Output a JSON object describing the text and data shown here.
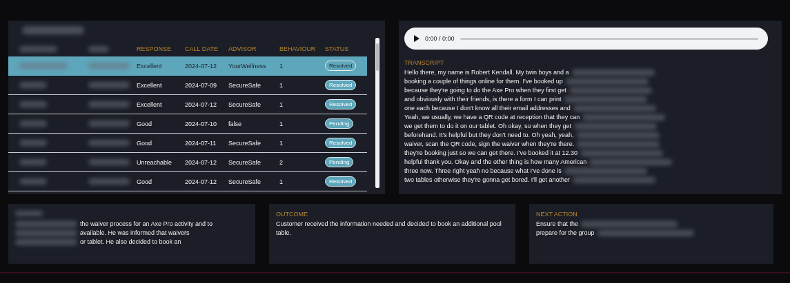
{
  "calls_table": {
    "columns": [
      {
        "kind": "blurred"
      },
      {
        "kind": "blurred"
      },
      {
        "kind": "text",
        "label": "RESPONSE"
      },
      {
        "kind": "text",
        "label": "CALL DATE"
      },
      {
        "kind": "text",
        "label": "ADVISOR"
      },
      {
        "kind": "text",
        "label": "BEHAVIOUR"
      },
      {
        "kind": "text",
        "label": "STATUS"
      }
    ],
    "rows": [
      {
        "selected": true,
        "response": "Excellent",
        "call_date": "2024-07-12",
        "advisor": "YourWellness",
        "behaviour": "1",
        "status": "Resolved"
      },
      {
        "selected": false,
        "response": "Excellent",
        "call_date": "2024-07-09",
        "advisor": "SecureSafe",
        "behaviour": "1",
        "status": "Resolved"
      },
      {
        "selected": false,
        "response": "Excellent",
        "call_date": "2024-07-12",
        "advisor": "SecureSafe",
        "behaviour": "1",
        "status": "Resolved"
      },
      {
        "selected": false,
        "response": "Good",
        "call_date": "2024-07-10",
        "advisor": "false",
        "behaviour": "1",
        "status": "Pending"
      },
      {
        "selected": false,
        "response": "Good",
        "call_date": "2024-07-11",
        "advisor": "SecureSafe",
        "behaviour": "1",
        "status": "Resolved"
      },
      {
        "selected": false,
        "response": "Unreachable",
        "call_date": "2024-07-12",
        "advisor": "SecureSafe",
        "behaviour": "2",
        "status": "Pending"
      },
      {
        "selected": false,
        "response": "Good",
        "call_date": "2024-07-12",
        "advisor": "SecureSafe",
        "behaviour": "1",
        "status": "Resolved"
      }
    ]
  },
  "audio_player": {
    "time": "0:00 / 0:00"
  },
  "transcript": {
    "heading": "TRANSCRIPT",
    "lines": [
      "Hello there, my name is Robert Kendall. My twin boys and a",
      "booking a couple of things online for them. I've booked up",
      "because they're going to do the Axe Pro when they first get",
      "and obviously with their friends, is there a form I can print",
      "one each because I don't know all their email addresses and",
      "Yeah, we usually, we have a QR code at reception that they can",
      "we get them to do it on our tablet. Oh okay, so when they get",
      "beforehand. It's helpful but they don't need to. Oh yeah, yeah,",
      "waiver, scan the QR code, sign the waiver when they're there.",
      "they're booking just so we can get there. I've booked it at 12.30",
      "helpful thank you. Okay and the other thing is how many American",
      "three now. Three right yeah no because what I've done is",
      "two tables otherwise they're gonna get bored. I'll get another"
    ]
  },
  "cards": [
    {
      "lines": [
        "the waiver process for an Axe Pro activity and to",
        "available. He was informed that waivers",
        "or tablet. He also decided to book an"
      ]
    },
    {
      "heading": "OUTCOME",
      "lines": [
        "Customer received the information needed and decided to book an additional pool",
        "table."
      ]
    },
    {
      "heading": "NEXT ACTION",
      "lines": [
        "Ensure that the",
        "prepare for the group"
      ]
    }
  ]
}
